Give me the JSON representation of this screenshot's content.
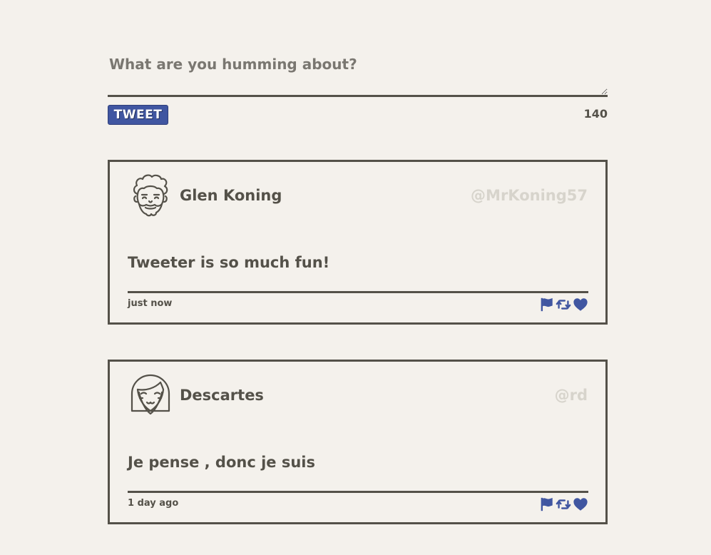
{
  "compose": {
    "placeholder": "What are you humming about?",
    "value": "",
    "button_label": "Tweet",
    "counter": "140"
  },
  "colors": {
    "accent": "#4056a1",
    "text": "#545149",
    "handle": "#d7d4cc",
    "background": "#f4f1ec"
  },
  "tweets": [
    {
      "avatar_icon": "curly-hair-man-avatar-icon",
      "name": "Glen Koning",
      "handle": "@MrKoning57",
      "content": "Tweeter is so much fun!",
      "timestamp": "just now",
      "actions": [
        "flag-icon",
        "retweet-icon",
        "heart-icon"
      ]
    },
    {
      "avatar_icon": "bob-hair-girl-avatar-icon",
      "name": "Descartes",
      "handle": "@rd",
      "content": "Je pense , donc je suis",
      "timestamp": "1 day ago",
      "actions": [
        "flag-icon",
        "retweet-icon",
        "heart-icon"
      ]
    }
  ]
}
